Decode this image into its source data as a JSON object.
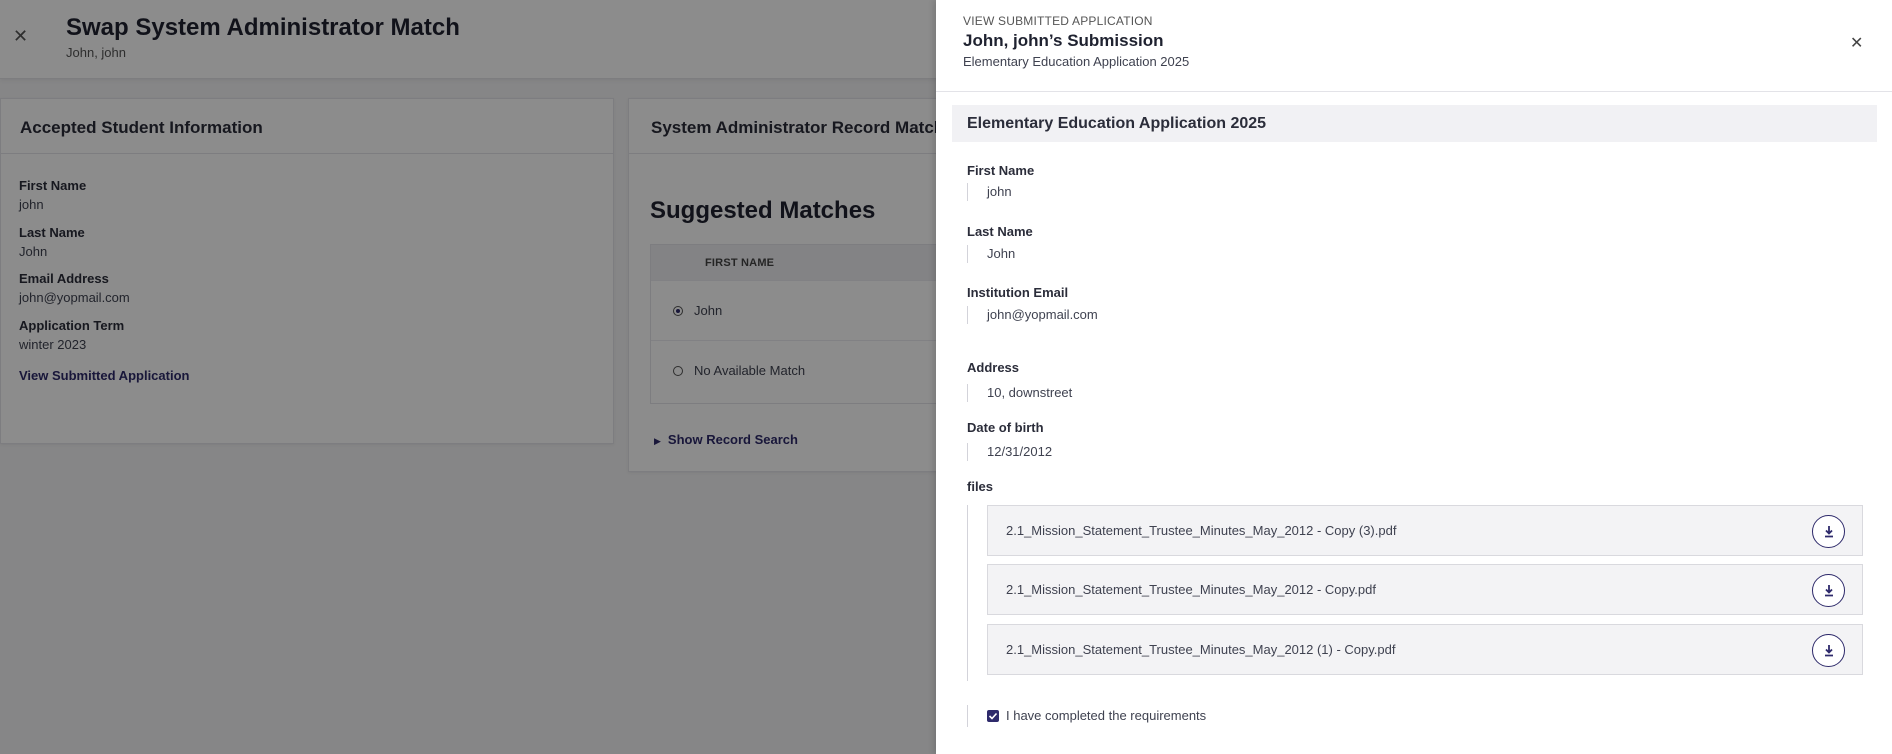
{
  "background": {
    "title": "Swap System Administrator Match",
    "subtitle": "John, john",
    "left_card": {
      "title": "Accepted Student Information",
      "fields": [
        {
          "label": "First Name",
          "value": "john"
        },
        {
          "label": "Last Name",
          "value": "John"
        },
        {
          "label": "Email Address",
          "value": "john@yopmail.com"
        },
        {
          "label": "Application Term",
          "value": "winter 2023"
        }
      ],
      "link": "View Submitted Application"
    },
    "right_card": {
      "title": "System Administrator Record Match",
      "suggested_title": "Suggested Matches",
      "column_header": "FIRST NAME",
      "rows": [
        {
          "label": "John",
          "selected": true
        },
        {
          "label": "No Available Match",
          "selected": false
        }
      ],
      "show_search": "Show Record Search"
    }
  },
  "drawer": {
    "kicker": "VIEW SUBMITTED APPLICATION",
    "title": "John, john’s Submission",
    "subtitle": "Elementary Education Application 2025",
    "section_title": "Elementary Education Application 2025",
    "fields": [
      {
        "label": "First Name",
        "value": "john"
      },
      {
        "label": "Last Name",
        "value": "John"
      },
      {
        "label": "Institution Email",
        "value": "john@yopmail.com"
      },
      {
        "label": "Address",
        "value": "10, downstreet"
      },
      {
        "label": "Date of birth",
        "value": "12/31/2012"
      }
    ],
    "files_label": "files",
    "files": [
      "2.1_Mission_Statement_Trustee_Minutes_May_2012 - Copy (3).pdf",
      "2.1_Mission_Statement_Trustee_Minutes_May_2012 - Copy.pdf",
      "2.1_Mission_Statement_Trustee_Minutes_May_2012 (1) - Copy.pdf"
    ],
    "requirement_checked": true,
    "requirement_label": "I have completed the requirements"
  },
  "colors": {
    "accent": "#2e2a6b",
    "overlay": "#000000"
  }
}
